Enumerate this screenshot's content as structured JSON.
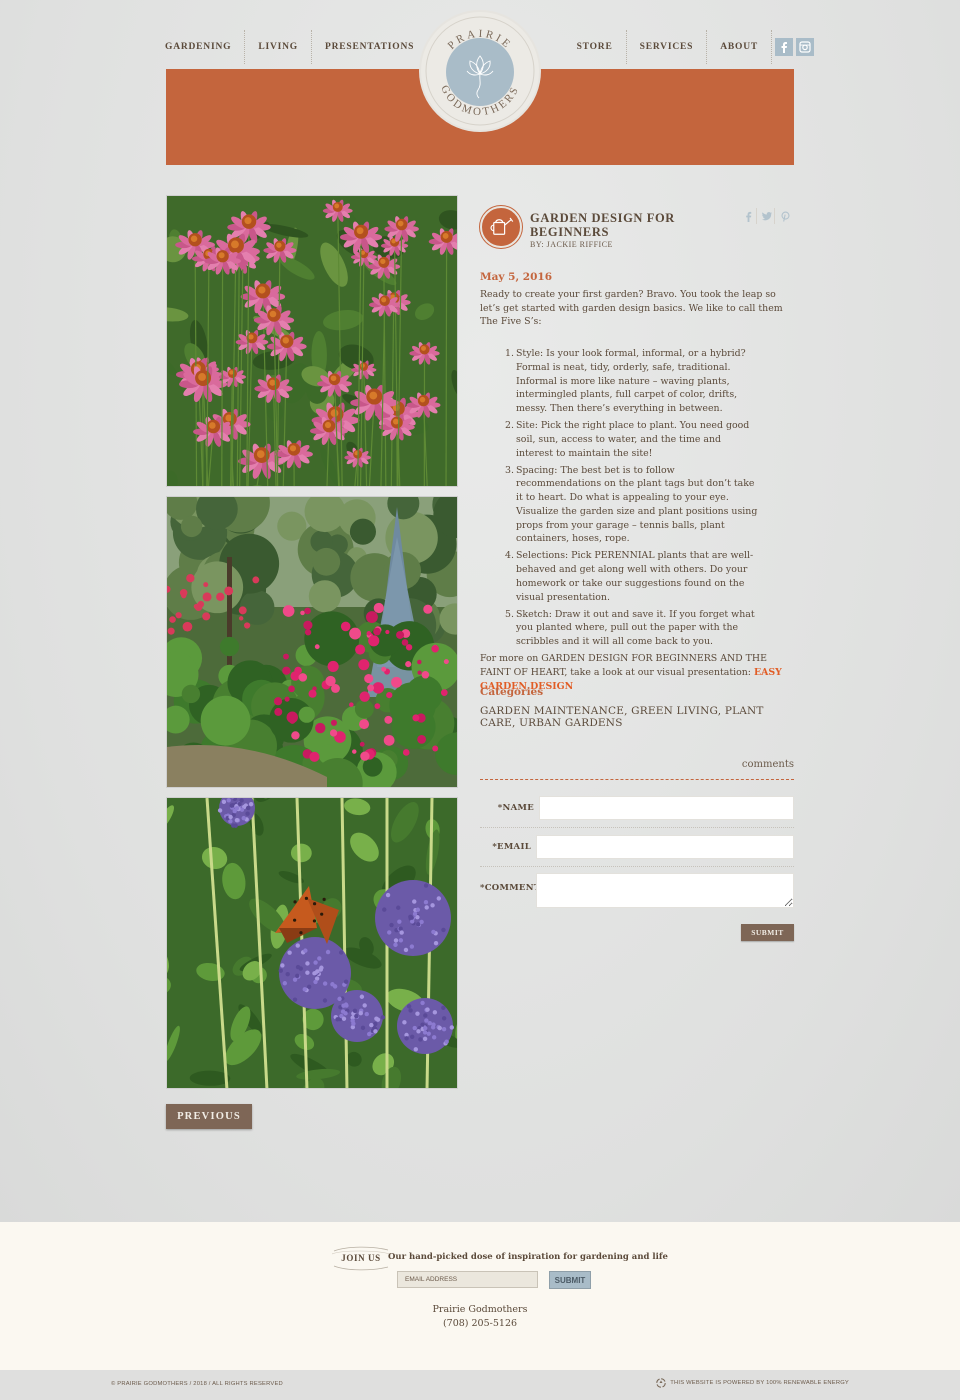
{
  "brand": {
    "logo_top": "PRAIRIE",
    "logo_bottom": "GODMOTHERS",
    "accent_color": "#c4653d",
    "logo_blue": "#a9bcc8"
  },
  "nav": {
    "left": [
      "GARDENING",
      "LIVING",
      "PRESENTATIONS"
    ],
    "right": [
      "STORE",
      "SERVICES",
      "ABOUT"
    ],
    "social": [
      "facebook-icon",
      "instagram-icon"
    ]
  },
  "photos": [
    {
      "icon": "coneflowers-photo"
    },
    {
      "icon": "garden-bed-photo"
    },
    {
      "icon": "butterfly-globe-thistle-photo"
    }
  ],
  "post": {
    "title": "GARDEN DESIGN FOR BEGINNERS",
    "byline": "BY: JACKIE RIFFICE",
    "date": "May 5, 2016",
    "intro": "Ready to create your first garden? Bravo. You took the leap so let’s get started with garden design basics. We like to call them The Five S’s:",
    "list": [
      {
        "num": "1.",
        "text": "Style: Is your look formal, informal, or a hybrid? Formal is neat, tidy, orderly, safe, traditional. Informal is more like nature – waving plants, intermingled plants, full carpet of color, drifts, messy. Then there’s everything in between."
      },
      {
        "num": "2.",
        "text": "Site: Pick the right place to plant. You need good soil, sun, access to water, and the time and interest to maintain the site!"
      },
      {
        "num": "3.",
        "text": "Spacing: The best bet is to follow recommendations on the plant tags but don’t take it to heart. Do what is appealing to your eye. Visualize the garden size and plant positions using props from your garage – tennis balls, plant containers, hoses, rope."
      },
      {
        "num": "4.",
        "text": "Selections: Pick PERENNIAL plants that are well-behaved and get along well with others. Do your homework or take our suggestions found on the visual presentation."
      },
      {
        "num": "5.",
        "text": "Sketch: Draw it out and save it. If you forget what you planted where, pull out the paper with the scribbles and it will all come back to you."
      }
    ],
    "more_text": "For more on GARDEN DESIGN FOR BEGINNERS AND THE FAINT OF HEART, take a look at our visual presentation: ",
    "more_link": "EASY GARDEN DESIGN",
    "categories_heading": "Categories",
    "categories": "GARDEN MAINTENANCE, GREEN LIVING, PLANT CARE, URBAN GARDENS",
    "share": [
      "facebook-icon",
      "twitter-icon",
      "pinterest-icon"
    ]
  },
  "comments": {
    "label": "comments",
    "name_label": "*NAME",
    "email_label": "*EMAIL",
    "comment_label": "*COMMENT",
    "name_value": "",
    "email_value": "",
    "comment_value": "",
    "submit": "SUBMIT"
  },
  "pagination": {
    "previous": "PREVIOUS"
  },
  "footer": {
    "join": "JOIN US",
    "tagline": "Our hand-picked dose of inspiration for gardening and life",
    "email_placeholder": "EMAIL ADDRESS",
    "submit": "SUBMIT",
    "name": "Prairie Godmothers",
    "phone": "(708) 205-5126",
    "copyright": "© PRAIRIE GODMOTHERS / 2018 / ALL RIGHTS RESERVED",
    "energy": "THIS WEBSITE IS POWERED BY 100% RENEWABLE ENERGY"
  }
}
